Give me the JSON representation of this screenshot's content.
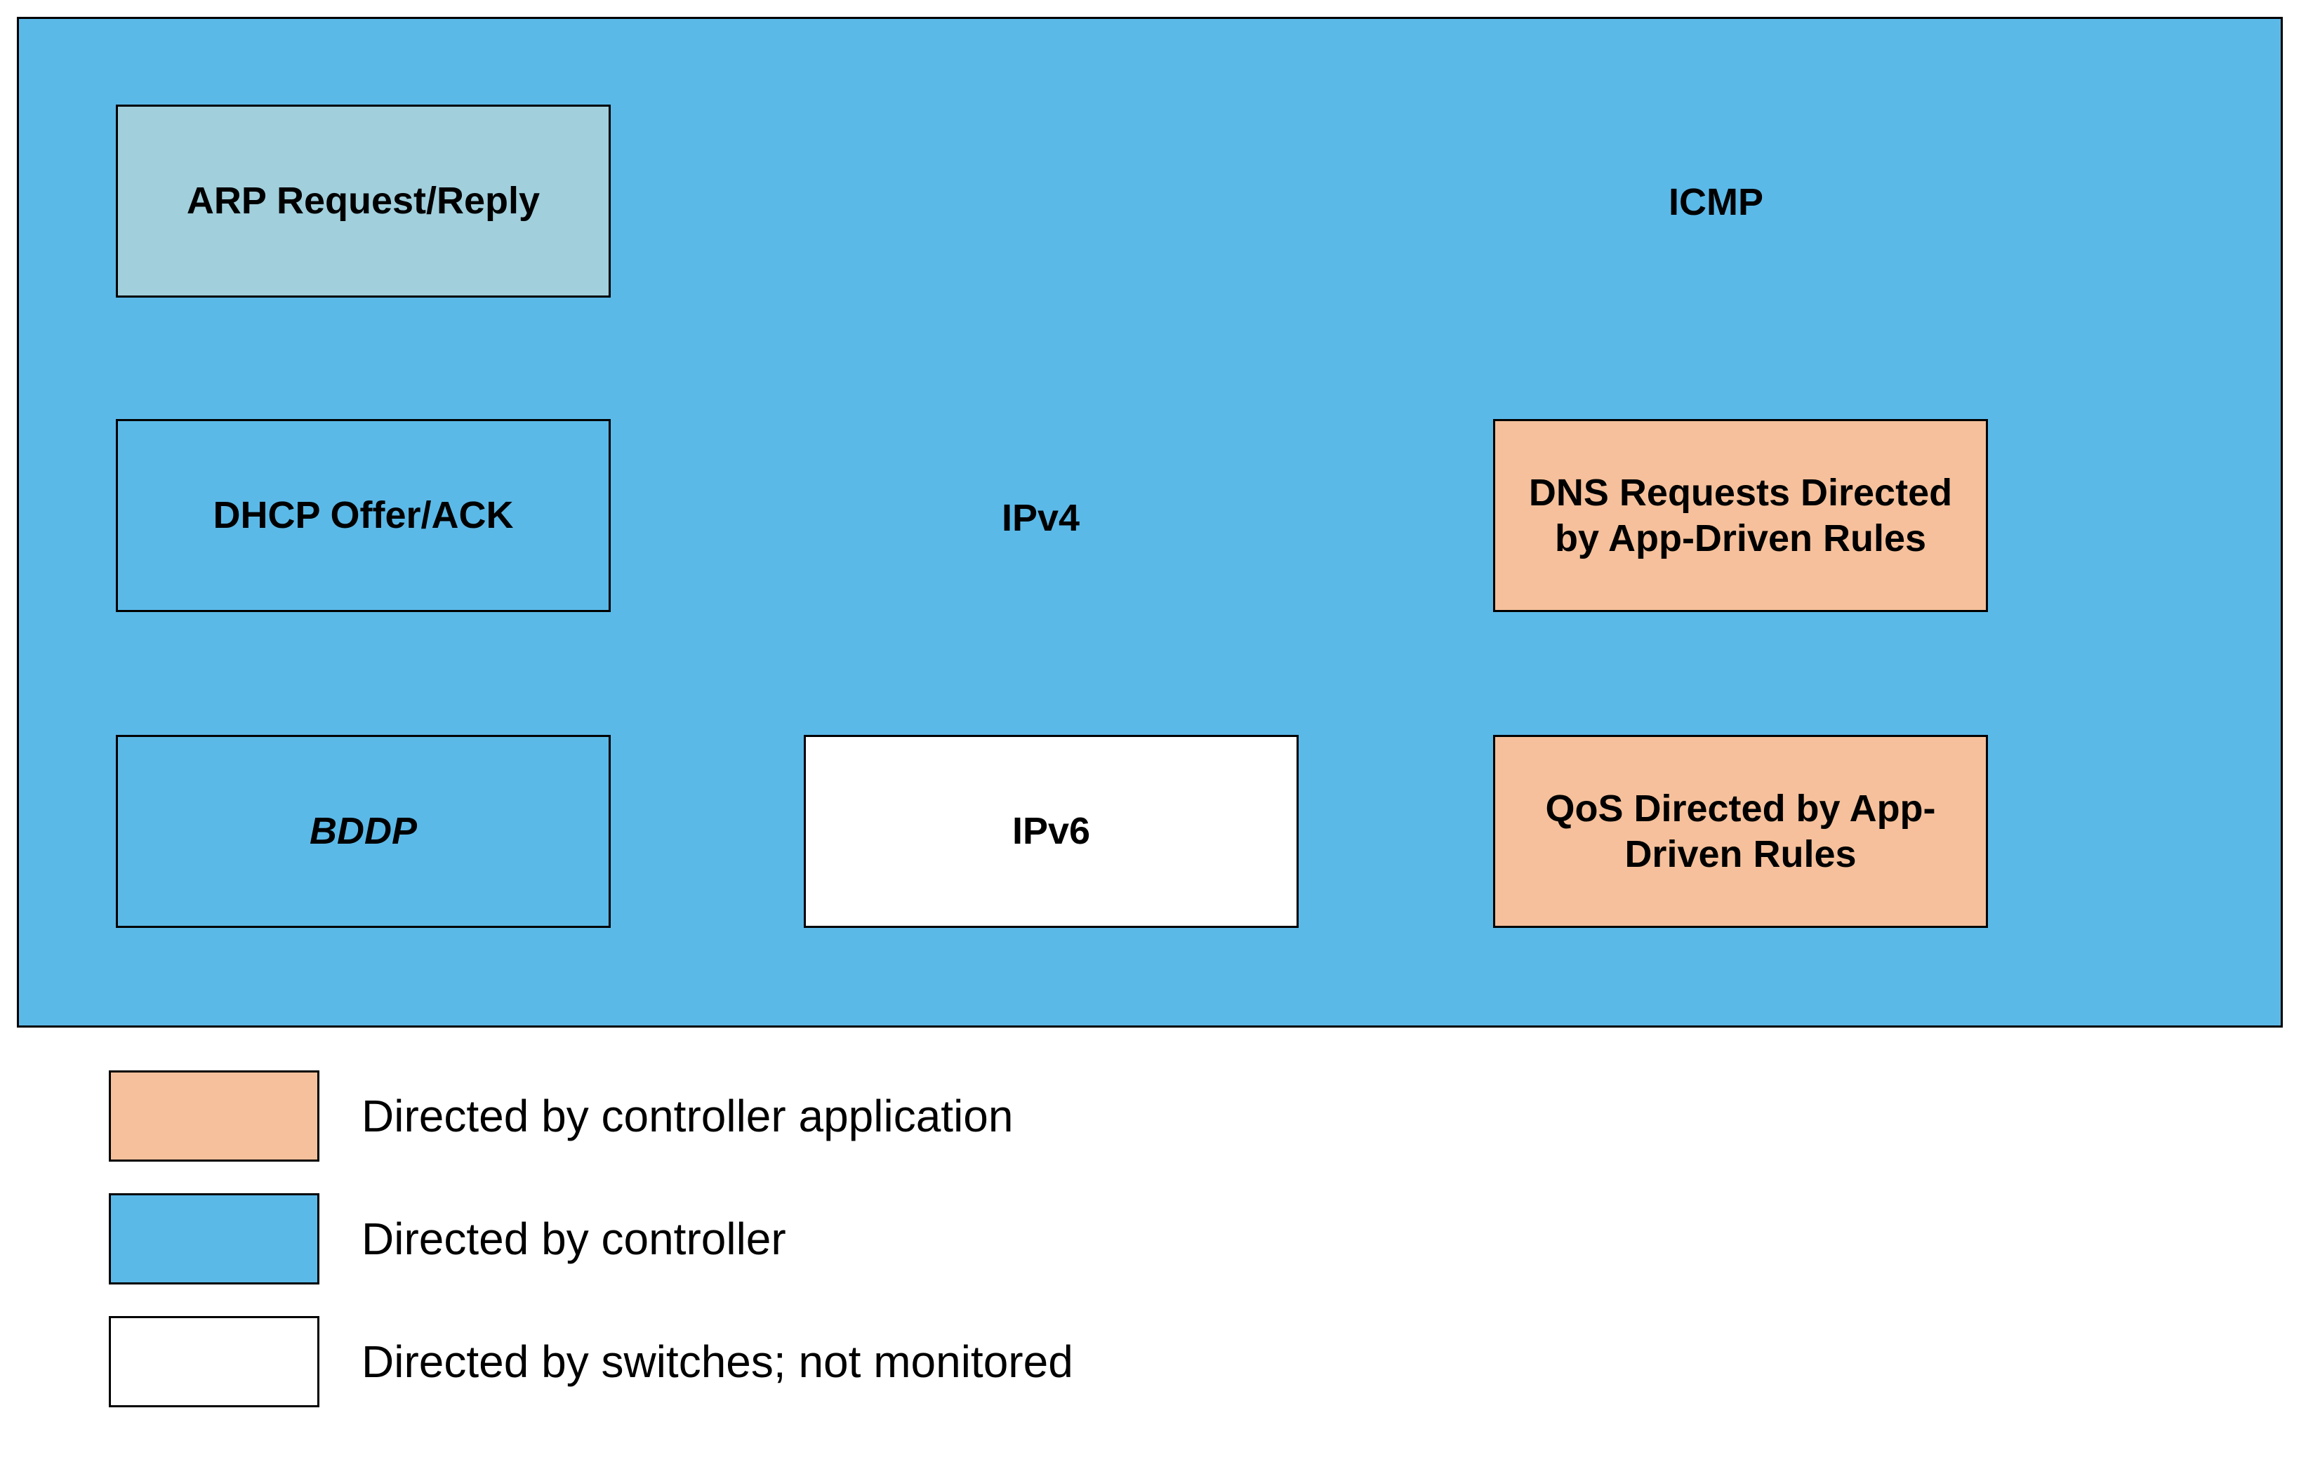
{
  "boxes": {
    "arp": "ARP Request/Reply",
    "dhcp": "DHCP Offer/ACK",
    "bddp": "BDDP",
    "ipv6": "IPv6",
    "dns": "DNS Requests Directed by App-Driven Rules",
    "qos": "QoS Directed by App-Driven Rules"
  },
  "labels": {
    "icmp": "ICMP",
    "ipv4": "IPv4"
  },
  "legend": {
    "controller_app": "Directed by controller application",
    "controller": "Directed by controller",
    "switches": "Directed by switches; not monitored"
  },
  "colors": {
    "controller_blue": "#5bb9e8",
    "controller_app_orange": "#f5c09b",
    "switches_white": "#ffffff",
    "arp_light_blue": "#a1cfdc"
  }
}
